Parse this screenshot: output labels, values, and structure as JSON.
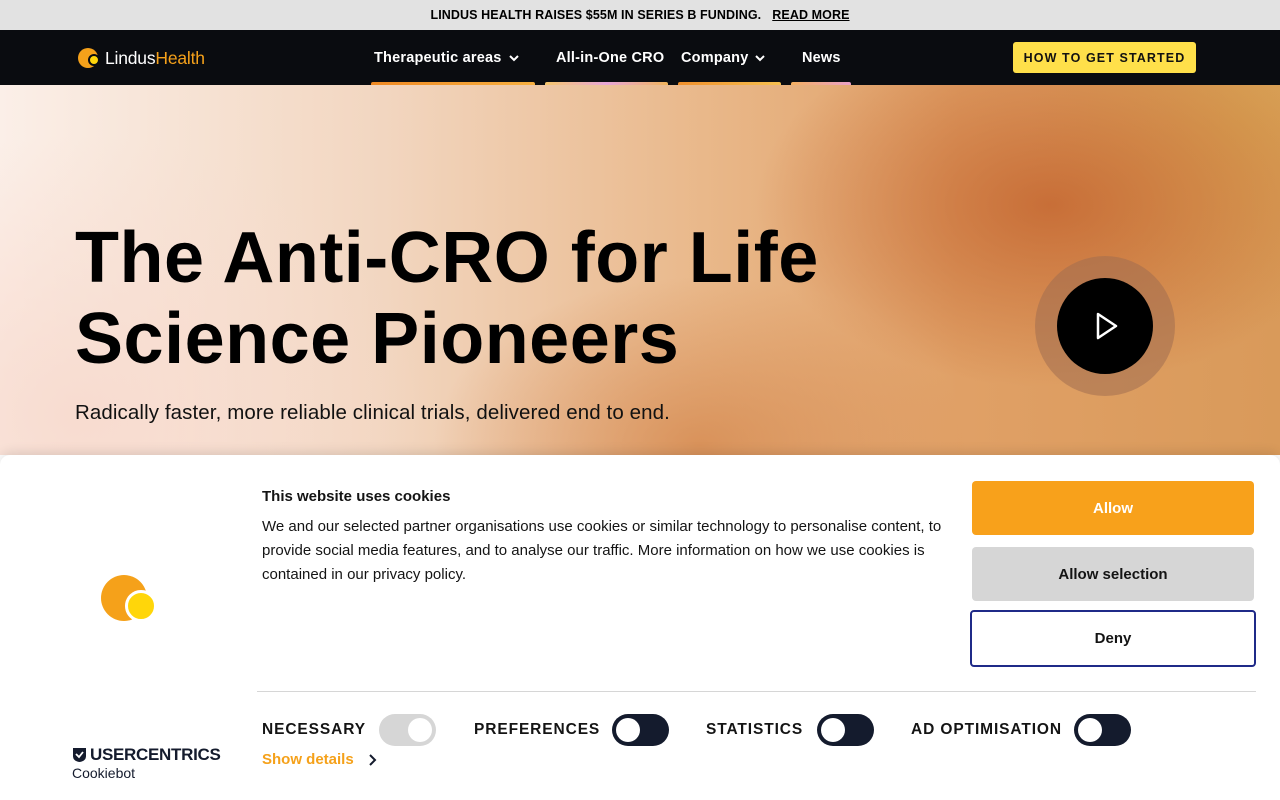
{
  "announcement": {
    "text": "LINDUS HEALTH RAISES $55M IN SERIES B FUNDING.",
    "link": "READ MORE"
  },
  "nav": {
    "logo_part1": "Lindus",
    "logo_part2": "Health",
    "items": [
      {
        "label": "Therapeutic areas",
        "has_dropdown": true
      },
      {
        "label": "All-in-One CRO",
        "has_dropdown": false
      },
      {
        "label": "Company",
        "has_dropdown": true
      },
      {
        "label": "News",
        "has_dropdown": false
      }
    ],
    "cta": "HOW TO GET STARTED"
  },
  "hero": {
    "title_line1": "The Anti-CRO for Life",
    "title_line2": "Science Pioneers",
    "subtitle": "Radically faster, more reliable clinical trials, delivered end to end.",
    "play_icon": "play-icon"
  },
  "cookie": {
    "title": "This website uses cookies",
    "text": "We and our selected partner organisations use cookies or similar technology to personalise content, to provide social media features, and to analyse our traffic. More information on how we use cookies is contained in our privacy policy.",
    "buttons": {
      "allow": "Allow",
      "allow_selection": "Allow selection",
      "deny": "Deny"
    },
    "toggles": [
      {
        "label": "NECESSARY",
        "state": "on",
        "disabled": true
      },
      {
        "label": "PREFERENCES",
        "state": "off",
        "disabled": false
      },
      {
        "label": "STATISTICS",
        "state": "off",
        "disabled": false
      },
      {
        "label": "AD OPTIMISATION",
        "state": "off",
        "disabled": false
      }
    ],
    "show_details": "Show details",
    "brand_name": "USERCENTRICS",
    "brand_sub": "Cookiebot"
  },
  "colors": {
    "accent_orange": "#f8a11b",
    "accent_yellow": "#ffe04a",
    "nav_bg": "#0a0c10",
    "deny_border": "#1f2a88"
  }
}
